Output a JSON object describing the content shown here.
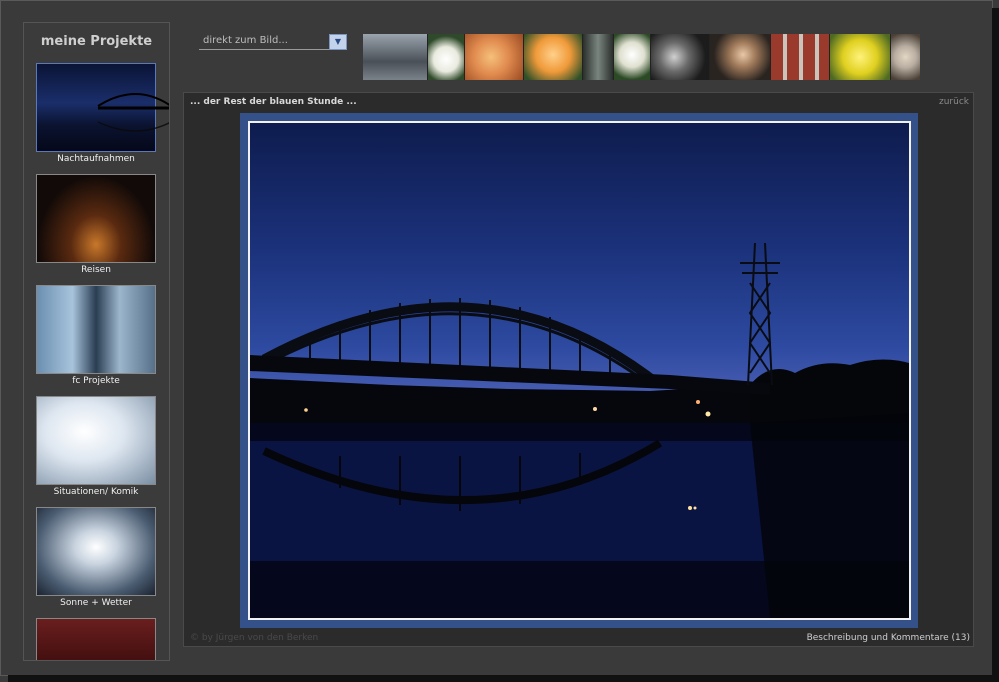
{
  "sidebar": {
    "title": "meine Projekte",
    "projects": [
      {
        "label": "Nachtaufnahmen",
        "thumb": "night-bridge-thumbnail",
        "active": true
      },
      {
        "label": "Reisen",
        "thumb": "city-night-thumbnail"
      },
      {
        "label": "fc Projekte",
        "thumb": "glass-facade-thumbnail"
      },
      {
        "label": "Situationen/ Komik",
        "thumb": "spray-thumbnail"
      },
      {
        "label": "Sonne + Wetter",
        "thumb": "sky-clouds-thumbnail"
      },
      {
        "label": "",
        "thumb": "vintage-car-thumbnail"
      }
    ]
  },
  "jump": {
    "value": "direkt zum Bild...",
    "icon": "chevron-down-icon"
  },
  "strip": [
    {
      "name": "strip-thumb-machine",
      "color": "#6d7680"
    },
    {
      "name": "strip-thumb-white-rose",
      "color": "#e9eadf"
    },
    {
      "name": "strip-thumb-orange-flower",
      "color": "#e08a4e"
    },
    {
      "name": "strip-thumb-hibiscus",
      "color": "#f09a3a"
    },
    {
      "name": "strip-thumb-glass",
      "color": "#4e5a55"
    },
    {
      "name": "strip-thumb-rose",
      "color": "#dfe0d0"
    },
    {
      "name": "strip-thumb-lamp",
      "color": "#3c3c3c"
    },
    {
      "name": "strip-thumb-portrait",
      "color": "#5a4a3a"
    },
    {
      "name": "strip-thumb-brick-building",
      "color": "#9a3a2c"
    },
    {
      "name": "strip-thumb-yellow-flower",
      "color": "#e0d020"
    },
    {
      "name": "strip-thumb-plates",
      "color": "#b8ada0"
    }
  ],
  "photo": {
    "title": "... der Rest der blauen Stunde ...",
    "back": "zurück",
    "image": "night-bridge-photo",
    "copyright": "© by Jürgen von den Berken",
    "comments": "Beschreibung und Kommentare (13)"
  },
  "colors": {
    "background": "#3a3a3a",
    "panel": "#2b2b2b",
    "mat": "#345189"
  }
}
